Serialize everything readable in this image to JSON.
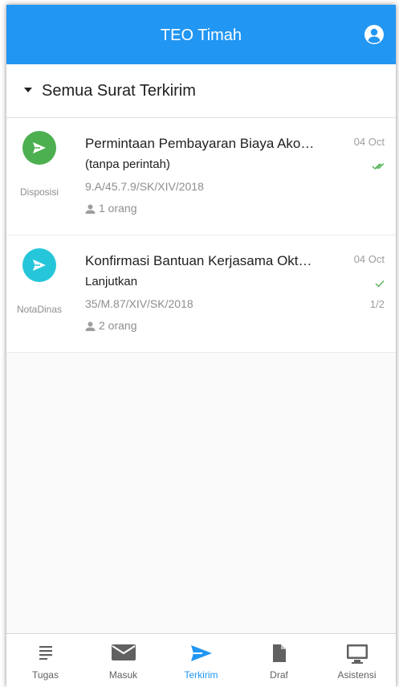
{
  "app": {
    "title": "TEO Timah",
    "account_icon": "account-circle-icon"
  },
  "colors": {
    "primary": "#2196f3",
    "disposisi": "#4caf50",
    "notadinas": "#26c6da",
    "check": "#4caf50"
  },
  "section": {
    "label": "Semua Surat Terkirim"
  },
  "letters": [
    {
      "subject": "Permintaan Pembayaran Biaya Ako…",
      "instruction": "(tanpa perintah)",
      "number": "9.A/45.7.9/SK/XIV/2018",
      "recipients": "1 orang",
      "date": "04 Oct",
      "type": "Disposisi",
      "status_icon": "double-check-icon",
      "pages": ""
    },
    {
      "subject": "Konfirmasi Bantuan Kerjasama Okt…",
      "instruction": "Lanjutkan",
      "number": "35/M.87/XIV/SK/2018",
      "recipients": "2 orang",
      "date": "04 Oct",
      "type": "NotaDinas",
      "status_icon": "check-icon",
      "pages": "1/2"
    }
  ],
  "nav": [
    {
      "label": "Tugas",
      "icon": "list-icon",
      "active": false
    },
    {
      "label": "Masuk",
      "icon": "mail-icon",
      "active": false
    },
    {
      "label": "Terkirim",
      "icon": "send-icon",
      "active": true
    },
    {
      "label": "Draf",
      "icon": "file-icon",
      "active": false
    },
    {
      "label": "Asistensi",
      "icon": "monitor-icon",
      "active": false
    }
  ]
}
